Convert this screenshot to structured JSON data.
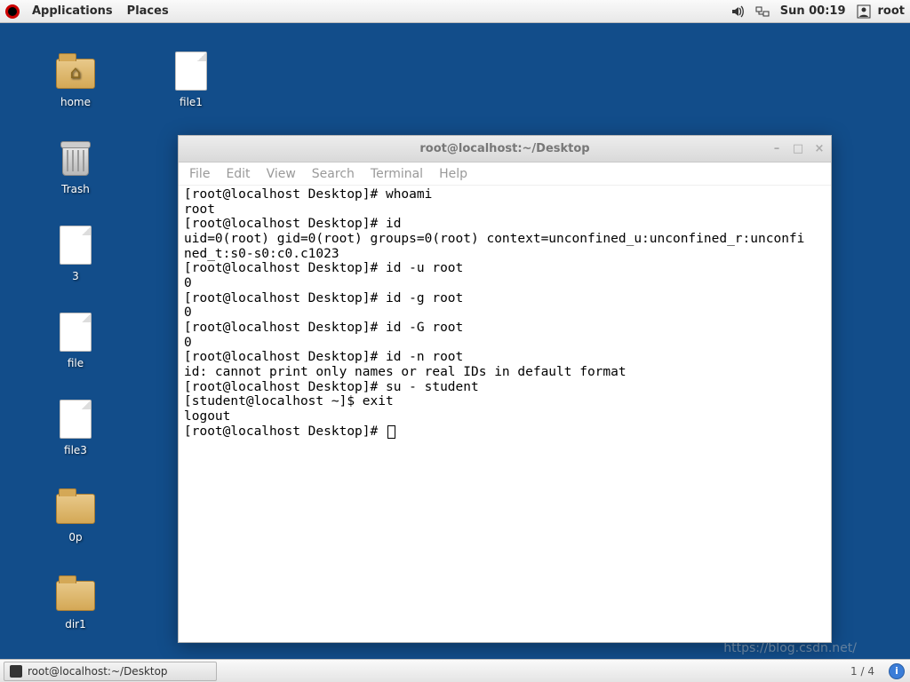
{
  "top_panel": {
    "applications": "Applications",
    "places": "Places",
    "clock": "Sun 00:19",
    "user": "root"
  },
  "desktop_icons": {
    "home": "home",
    "file1": "file1",
    "trash": "Trash",
    "three": "3",
    "file": "file",
    "file3": "file3",
    "zero_p": "0p",
    "dir1": "dir1"
  },
  "window": {
    "title": "root@localhost:~/Desktop",
    "menubar": {
      "file": "File",
      "edit": "Edit",
      "view": "View",
      "search": "Search",
      "terminal": "Terminal",
      "help": "Help"
    },
    "terminal_lines": [
      "[root@localhost Desktop]# whoami",
      "root",
      "[root@localhost Desktop]# id",
      "uid=0(root) gid=0(root) groups=0(root) context=unconfined_u:unconfined_r:unconfi",
      "ned_t:s0-s0:c0.c1023",
      "[root@localhost Desktop]# id -u root",
      "0",
      "[root@localhost Desktop]# id -g root",
      "0",
      "[root@localhost Desktop]# id -G root",
      "0",
      "[root@localhost Desktop]# id -n root",
      "id: cannot print only names or real IDs in default format",
      "[root@localhost Desktop]# su - student",
      "[student@localhost ~]$ exit",
      "logout",
      "[root@localhost Desktop]# "
    ]
  },
  "taskbar": {
    "task_label": "root@localhost:~/Desktop",
    "workspace": "1 / 4"
  },
  "watermark": "https://blog.csdn.net/"
}
